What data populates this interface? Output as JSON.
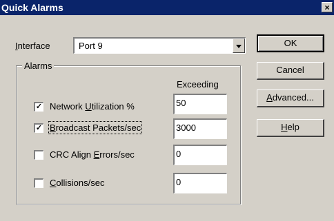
{
  "window": {
    "title": "Quick Alarms",
    "close_glyph": "×"
  },
  "interface": {
    "label_key": "I",
    "label_rest": "nterface",
    "selected": "Port 9"
  },
  "alarms": {
    "group_label": "Alarms",
    "column_header": "Exceeding",
    "rows": [
      {
        "pre": "Network ",
        "key": "U",
        "post": "tilization %",
        "checked": true,
        "value": "50"
      },
      {
        "pre": "",
        "key": "B",
        "post": "roadcast Packets/sec",
        "checked": true,
        "value": "3000"
      },
      {
        "pre": "CRC Align ",
        "key": "E",
        "post": "rrors/sec",
        "checked": false,
        "value": "0"
      },
      {
        "pre": "",
        "key": "C",
        "post": "ollisions/sec",
        "checked": false,
        "value": "0"
      }
    ]
  },
  "buttons": {
    "ok": "OK",
    "cancel": "Cancel",
    "advanced_key": "A",
    "advanced_rest": "dvanced...",
    "help_key": "H",
    "help_rest": "elp"
  },
  "check_glyph": "✓"
}
